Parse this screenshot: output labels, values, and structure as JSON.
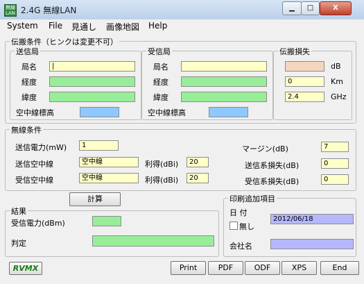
{
  "window": {
    "title": "2.4G 無線LAN",
    "icon_text": "無線LAN",
    "buttons": {
      "minimize": "▁",
      "maximize": "□",
      "close": "X"
    }
  },
  "menu": [
    "System",
    "File",
    "見通し",
    "画像地図",
    "Help"
  ],
  "propagation": {
    "legend": "伝搬条件（ヒンクは変更不可）",
    "tx": {
      "legend": "送信局",
      "name_label": "局名",
      "name_value": "|",
      "lon_label": "経度",
      "lat_label": "緯度",
      "height_label": "空中線標高"
    },
    "rx": {
      "legend": "受信局",
      "name_label": "局名",
      "lon_label": "経度",
      "lat_label": "緯度",
      "height_label": "空中線標高"
    },
    "loss": {
      "legend": "伝搬損失",
      "db_unit": "dB",
      "km_value": "0",
      "km_unit": "Km",
      "ghz_value": "2.4",
      "ghz_unit": "GHz"
    }
  },
  "radio": {
    "legend": "無線条件",
    "tx_power_label": "送信電力(mW)",
    "tx_power_value": "1",
    "tx_antenna_label": "送信空中線",
    "tx_antenna_value": "空中線",
    "tx_gain_label": "利得(dBi)",
    "tx_gain_value": "20",
    "rx_antenna_label": "受信空中線",
    "rx_antenna_value": "空中線",
    "rx_gain_label": "利得(dBi)",
    "rx_gain_value": "20",
    "margin_label": "マージン(dB)",
    "margin_value": "7",
    "tx_loss_label": "送信系損失(dB)",
    "tx_loss_value": "0",
    "rx_loss_label": "受信系損失(dB)",
    "rx_loss_value": "0"
  },
  "calc_button": "計算",
  "result": {
    "legend": "結果",
    "rx_power_label": "受信電力(dBm)",
    "judge_label": "判定"
  },
  "print_extra": {
    "legend": "印刷追加項目",
    "date_label": "日 付",
    "none_label": "無し",
    "date_value": "2012/06/18",
    "company_label": "会社名"
  },
  "logo": "RVMX",
  "actions": [
    "Print",
    "PDF",
    "ODF",
    "XPS",
    "End"
  ],
  "colors": {
    "yellow": "#ffffc8",
    "green": "#98ee98",
    "blue": "#8ec8ff",
    "peach": "#f5d5bf",
    "lavender": "#b5b8fb"
  }
}
